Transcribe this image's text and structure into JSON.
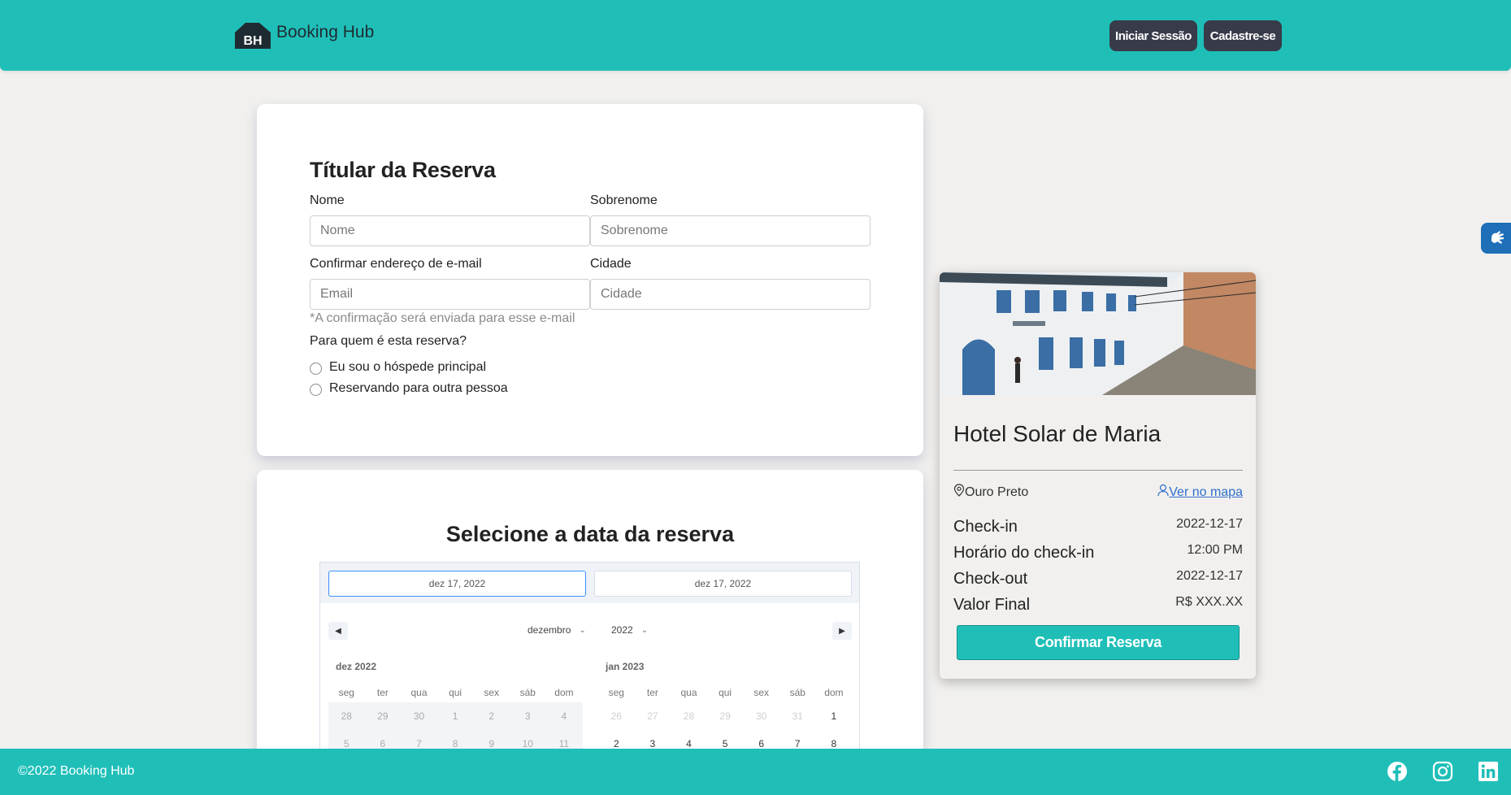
{
  "header": {
    "logo_mark": "BH",
    "brand": "Booking Hub",
    "login_label": "Iniciar Sessão",
    "signup_label": "Cadastre-se"
  },
  "holder_form": {
    "title": "Títular da Reserva",
    "first_name": {
      "label": "Nome",
      "placeholder": "Nome",
      "value": ""
    },
    "last_name": {
      "label": "Sobrenome",
      "placeholder": "Sobrenome",
      "value": ""
    },
    "email": {
      "label": "Confirmar endereço de e-mail",
      "placeholder": "Email",
      "value": ""
    },
    "city": {
      "label": "Cidade",
      "placeholder": "Cidade",
      "value": ""
    },
    "email_hint": "*A confirmação será enviada para esse e-mail",
    "question": "Para quem é esta reserva?",
    "options": [
      "Eu sou o hóspede principal",
      "Reservando para outra pessoa"
    ]
  },
  "date_section": {
    "title": "Selecione a data da reserva",
    "start_date": "dez 17, 2022",
    "end_date": "dez 17, 2022",
    "month_select": "dezembro",
    "year_select": "2022",
    "prev_icon": "triangle-left-icon",
    "next_icon": "triangle-right-icon",
    "weekdays": [
      "seg",
      "ter",
      "qua",
      "qui",
      "sex",
      "sáb",
      "dom"
    ],
    "month1": {
      "label": "dez 2022",
      "row1": [
        "28",
        "29",
        "30",
        "1",
        "2",
        "3",
        "4"
      ],
      "row2": [
        "5",
        "6",
        "7",
        "8",
        "9",
        "10",
        "11"
      ]
    },
    "month2": {
      "label": "jan 2023",
      "row1": [
        "26",
        "27",
        "28",
        "29",
        "30",
        "31",
        "1"
      ],
      "row2": [
        "2",
        "3",
        "4",
        "5",
        "6",
        "7",
        "8"
      ]
    }
  },
  "hotel": {
    "name": "Hotel Solar de Maria",
    "city": "Ouro Preto",
    "map_link": "Ver no mapa",
    "rows": [
      {
        "label": "Check-in",
        "value": "2022-12-17"
      },
      {
        "label": "Horário do check-in",
        "value": "12:00 PM"
      },
      {
        "label": "Check-out",
        "value": "2022-12-17"
      },
      {
        "label": "Valor Final",
        "value": "R$ XXX.XX"
      }
    ],
    "confirm_label": "Confirmar Reserva"
  },
  "footer": {
    "copyright": "©2022 Booking Hub",
    "social_icons": [
      "facebook-icon",
      "instagram-icon",
      "linkedin-icon"
    ]
  },
  "colors": {
    "brand_teal": "#1fbfb8",
    "dark_button": "#383b4a",
    "link_blue": "#2f6fce"
  }
}
